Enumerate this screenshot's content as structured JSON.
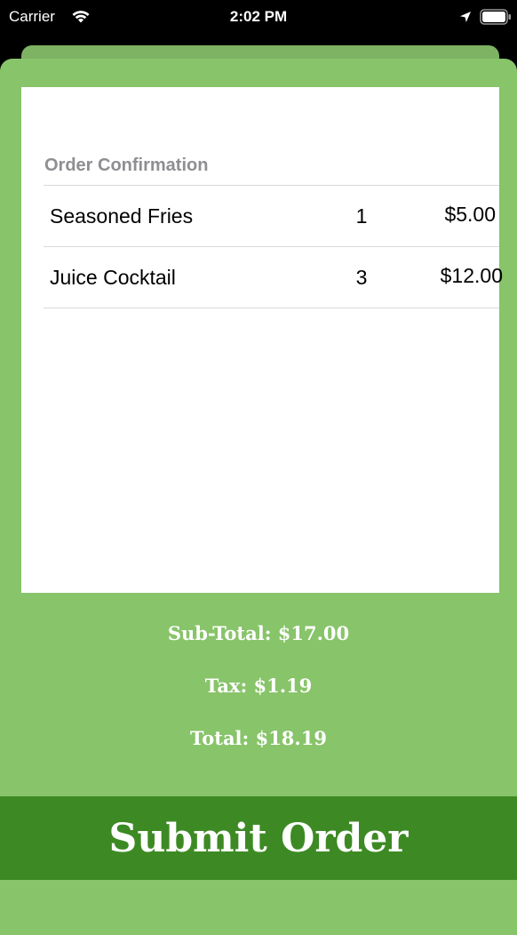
{
  "status_bar": {
    "carrier": "Carrier",
    "time": "2:02 PM",
    "icons": [
      "wifi-icon",
      "location-icon",
      "battery-icon"
    ]
  },
  "order": {
    "header": "Order Confirmation",
    "items": [
      {
        "name": "Seasoned Fries",
        "quantity": "1",
        "price": "$5.00"
      },
      {
        "name": "Juice Cocktail",
        "quantity": "3",
        "price": "$12.00"
      }
    ]
  },
  "summary": {
    "subtotal": "Sub-Total: $17.00",
    "tax": "Tax: $1.19",
    "total": "Total: $18.19"
  },
  "submit_label": "Submit Order",
  "colors": {
    "sheet_background": "#88c46a",
    "sheet_back": "#7db363",
    "submit_background": "#3d8a24",
    "card_background": "#ffffff",
    "header_text": "#8e8e93"
  }
}
